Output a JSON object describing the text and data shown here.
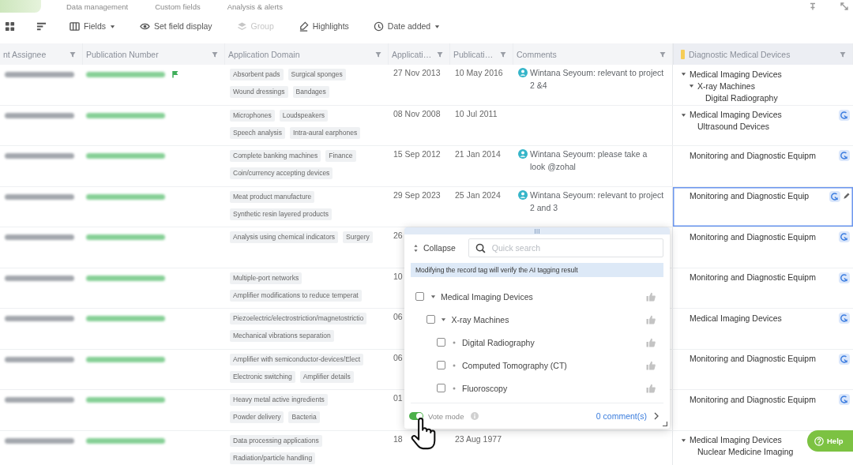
{
  "tabs": [
    {
      "selected": true
    },
    {
      "label": "Data management",
      "selected": false
    },
    {
      "label": "Custom fields",
      "selected": false
    },
    {
      "label": "Analysis & alerts",
      "selected": false
    }
  ],
  "toolbar": {
    "items": [
      {
        "kind": "icon",
        "disabled": false
      },
      {
        "kind": "icon",
        "disabled": false
      },
      {
        "kind": "dropdown",
        "label": "Fields",
        "disabled": false
      },
      {
        "kind": "button",
        "label": "Set field display",
        "disabled": false
      },
      {
        "kind": "button",
        "label": "Group",
        "disabled": true
      },
      {
        "kind": "button",
        "label": "Highlights",
        "disabled": false
      },
      {
        "kind": "dropdown",
        "label": "Date added",
        "disabled": false
      }
    ]
  },
  "table": {
    "columns": [
      {
        "label": "nt Assignee",
        "kind": "text"
      },
      {
        "label": "Publication Number",
        "kind": "text"
      },
      {
        "label": "Application Domain",
        "kind": "text"
      },
      {
        "label": "Applicati…",
        "kind": "text"
      },
      {
        "label": "Publicati…",
        "kind": "text"
      },
      {
        "label": "Comments",
        "kind": "text"
      },
      {
        "label": "Diagnostic Medical Devices",
        "kind": "category"
      }
    ],
    "rows": [
      {
        "flagged": true,
        "domains": [
          "Absorbent pads",
          "Surgical sponges",
          "Wound dressings",
          "Bandages"
        ],
        "application_date": "27 Nov 2013",
        "publication_date": "10 May 2016",
        "comment": "Wintana Seyoum: relevant to project 2 &4",
        "diagnostic": {
          "selected": false,
          "ai": false,
          "tags": [
            {
              "label": "Medical Imaging Devices",
              "expanded": true,
              "children": [
                {
                  "label": "X-ray Machines",
                  "expanded": true,
                  "children": [
                    {
                      "label": "Digital Radiography"
                    }
                  ]
                }
              ]
            }
          ]
        }
      },
      {
        "flagged": false,
        "domains": [
          "Microphones",
          "Loudspeakers",
          "Speech analysis",
          "Intra-aural earphones"
        ],
        "application_date": "08 Nov 2008",
        "publication_date": "10 Jul 2011",
        "diagnostic": {
          "selected": false,
          "ai": true,
          "tags": [
            {
              "label": "Medical Imaging Devices",
              "expanded": true,
              "children": [
                {
                  "label": "Ultrasound Devices"
                }
              ]
            }
          ]
        }
      },
      {
        "flagged": false,
        "domains": [
          "Complete banking machines",
          "Finance",
          "Coin/currency accepting devices"
        ],
        "application_date": "15 Sep 2012",
        "publication_date": "21 Jan 2014",
        "comment": "Wintana Seyoum: please take a look @zohal",
        "diagnostic": {
          "selected": false,
          "ai": true,
          "tags": [
            {
              "label": "Monitoring and Diagnostic Equipm"
            }
          ]
        }
      },
      {
        "flagged": false,
        "domains": [
          "Meat product manufacture",
          "Synthetic resin layered products"
        ],
        "application_date": "29 Sep 2023",
        "publication_date": "25 Jan 2024",
        "comment": "Wintana Seyoum: relevant to project 2 and 3",
        "diagnostic": {
          "selected": true,
          "ai": true,
          "tags": [
            {
              "label": "Monitoring and Diagnostic Equip"
            }
          ]
        }
      },
      {
        "flagged": false,
        "domains": [
          "Analysis using chemical indicators",
          "Surgery"
        ],
        "application_date": "26",
        "diagnostic": {
          "selected": false,
          "ai": true,
          "tags": [
            {
              "label": "Monitoring and Diagnostic Equipm"
            }
          ]
        }
      },
      {
        "flagged": false,
        "domains": [
          "Multiple-port networks",
          "Amplifier modifications to reduce temperat"
        ],
        "application_date": "10",
        "diagnostic": {
          "selected": false,
          "ai": true,
          "tags": [
            {
              "label": "Monitoring and Diagnostic Equipm"
            }
          ]
        }
      },
      {
        "flagged": false,
        "domains": [
          "Piezoelectric/electrostriction/magnetostrictio",
          "Mechanical vibrations separation"
        ],
        "application_date": "06",
        "diagnostic": {
          "selected": false,
          "ai": true,
          "tags": [
            {
              "label": "Medical Imaging Devices"
            }
          ]
        }
      },
      {
        "flagged": false,
        "domains": [
          "Amplifier with semiconductor-devices/Elect",
          "Electronic switching",
          "Amplifier details"
        ],
        "application_date": "06",
        "diagnostic": {
          "selected": false,
          "ai": true,
          "tags": [
            {
              "label": "Monitoring and Diagnostic Equipm"
            }
          ]
        }
      },
      {
        "flagged": false,
        "domains": [
          "Heavy metal active ingredients",
          "Powder delivery",
          "Bacteria"
        ],
        "application_date": "01",
        "diagnostic": {
          "selected": false,
          "ai": true,
          "tags": [
            {
              "label": "Monitoring and Diagnostic Equipm"
            }
          ]
        }
      },
      {
        "flagged": false,
        "domains": [
          "Data processing applications",
          "Radiation/particle handling"
        ],
        "application_date": "18",
        "publication_date": "23 Aug 1977",
        "diagnostic": {
          "selected": false,
          "ai": false,
          "tags": [
            {
              "label": "Medical Imaging Devices",
              "expanded": true,
              "children": [
                {
                  "label": "Nuclear Medicine Imaging"
                }
              ]
            }
          ]
        }
      }
    ]
  },
  "tag_picker": {
    "collapse": "Collapse",
    "search": {
      "placeholder": "Quick search"
    },
    "notice": "Modifying the record tag will verify the AI tagging result",
    "tree": [
      {
        "label": "Medical Imaging Devices",
        "checked": false,
        "expanded": true,
        "children": [
          {
            "label": "X-ray Machines",
            "checked": false,
            "expanded": true,
            "children": [
              {
                "label": "Digital Radiography",
                "checked": false
              },
              {
                "label": "Computed Tomography (CT)",
                "checked": false
              },
              {
                "label": "Fluoroscopy",
                "checked": false
              }
            ]
          }
        ]
      }
    ],
    "vote_mode": {
      "label": "Vote mode",
      "on": true
    },
    "comments_link": "0 comment(s)"
  },
  "help_button": {
    "label": "Help"
  }
}
